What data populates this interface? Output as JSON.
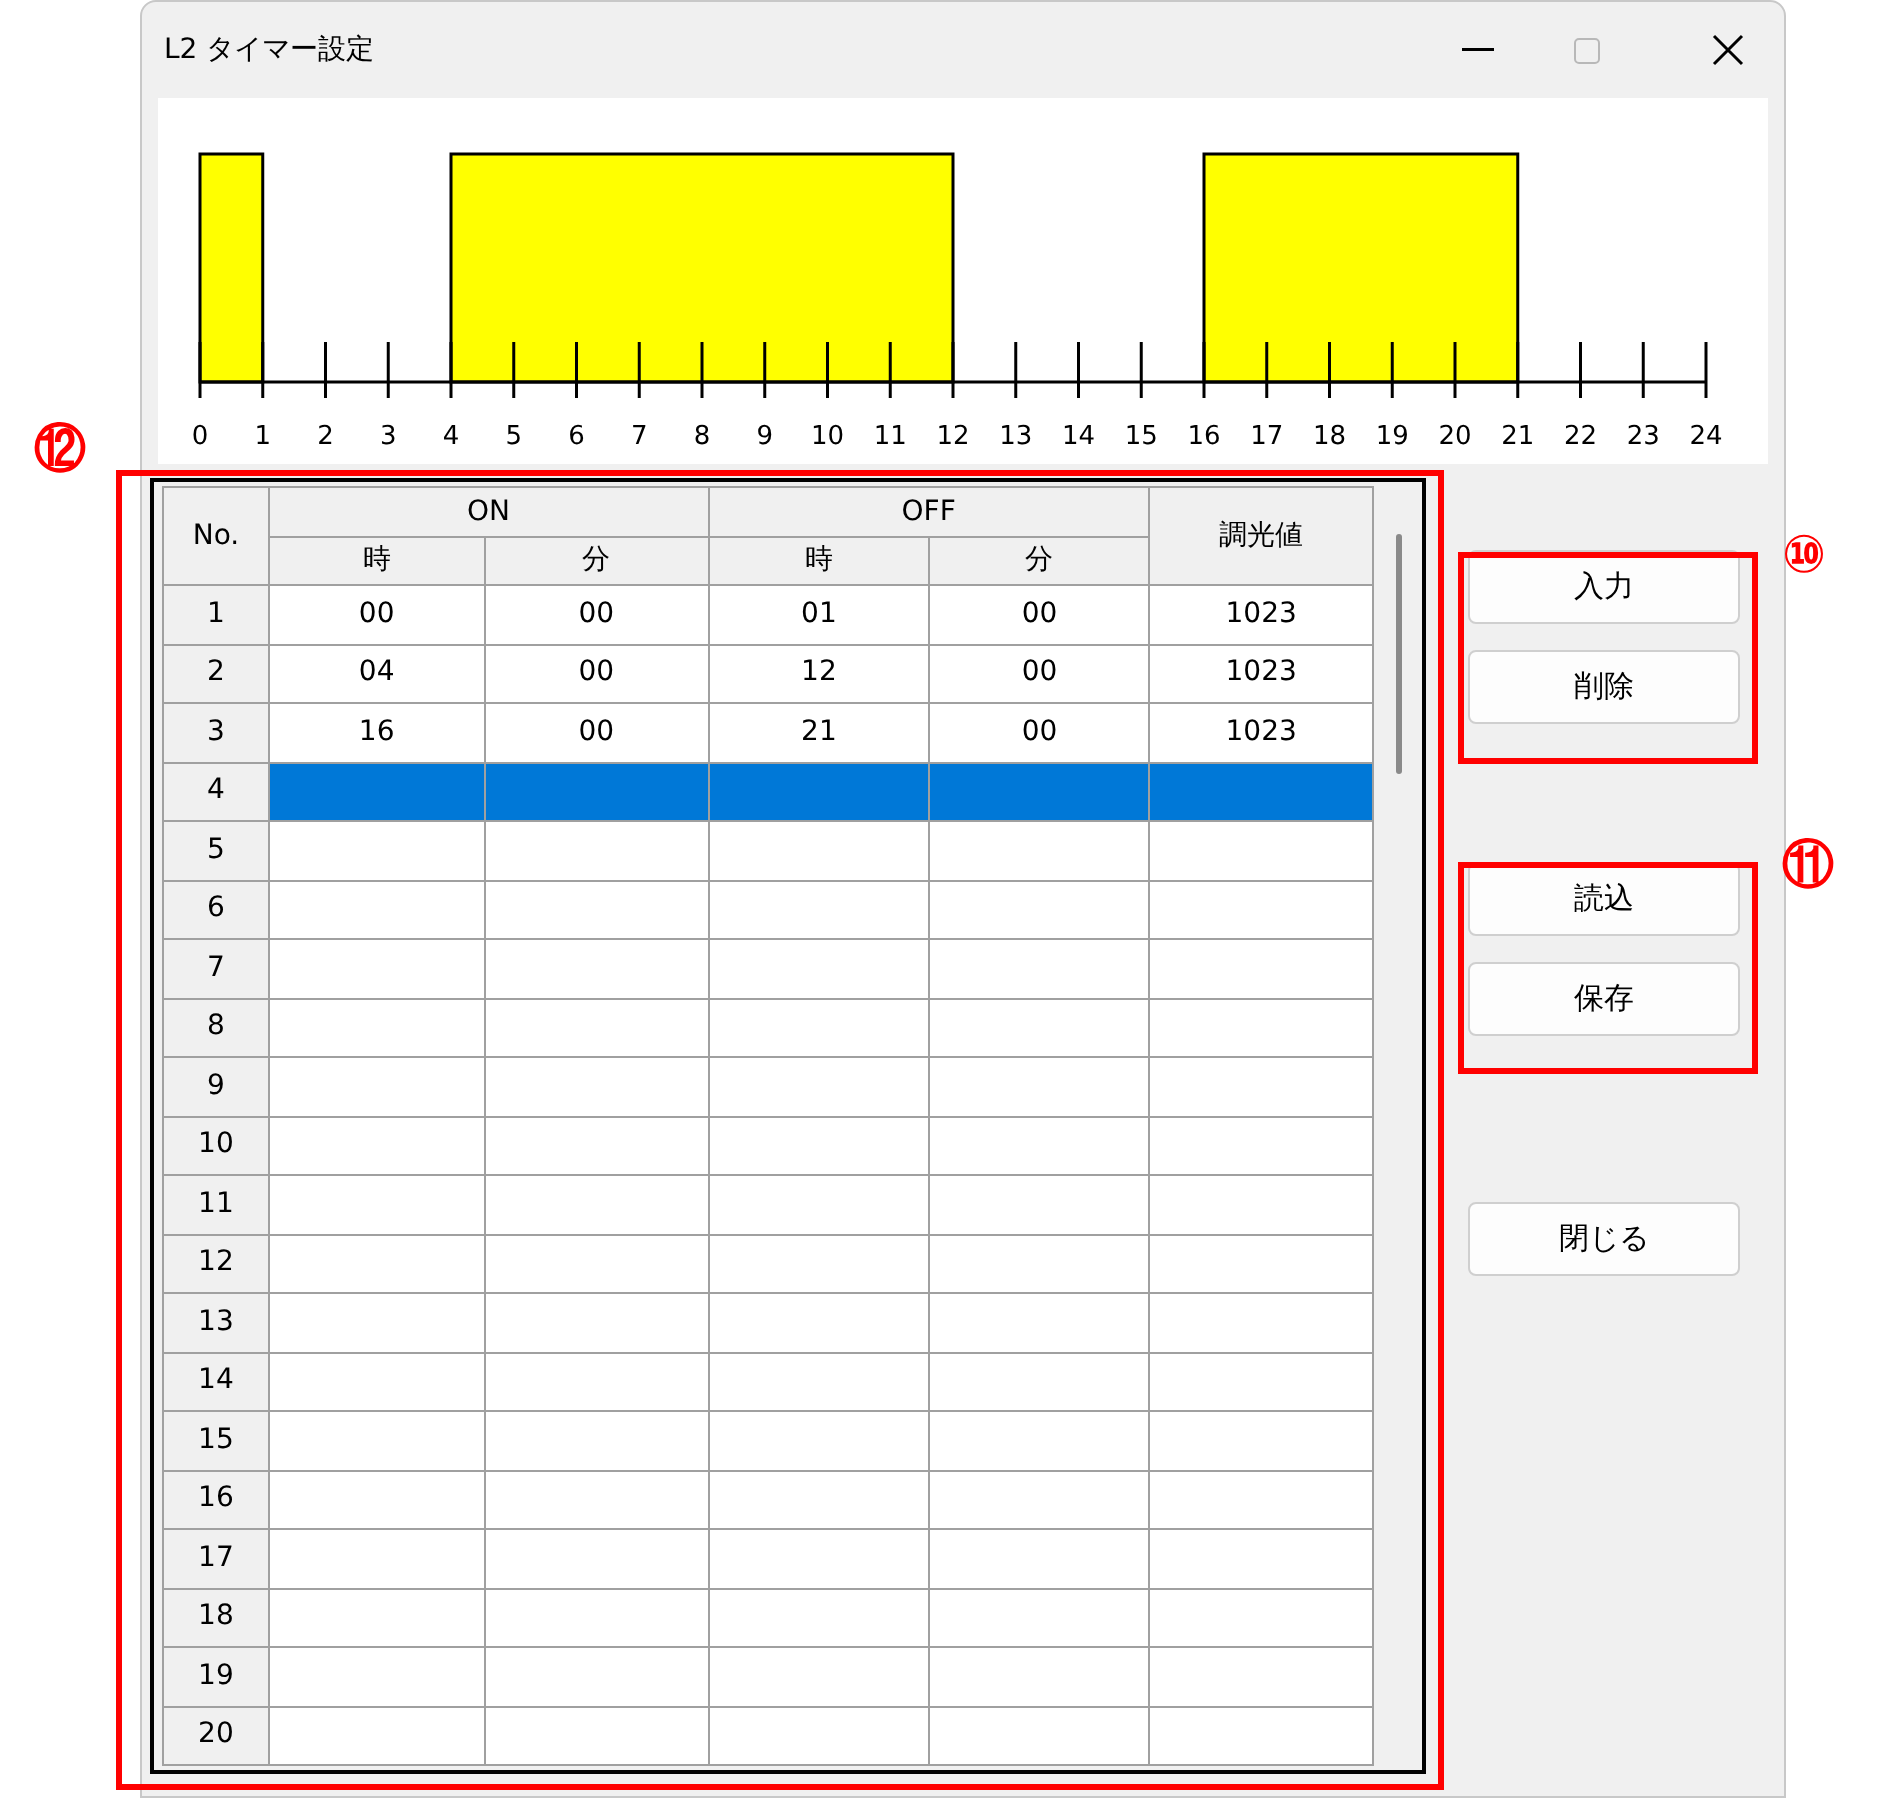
{
  "window": {
    "title": "L2 タイマー設定"
  },
  "timeline": {
    "ticks": [
      "0",
      "1",
      "2",
      "3",
      "4",
      "5",
      "6",
      "7",
      "8",
      "9",
      "10",
      "11",
      "12",
      "13",
      "14",
      "15",
      "16",
      "17",
      "18",
      "19",
      "20",
      "21",
      "22",
      "23",
      "24"
    ]
  },
  "table": {
    "annotation": "⑫",
    "headers": {
      "no": "No.",
      "on": "ON",
      "off": "OFF",
      "on_hour": "時",
      "on_min": "分",
      "off_hour": "時",
      "off_min": "分",
      "dimming": "調光値"
    },
    "rows": [
      {
        "no": "1",
        "on_hour": "00",
        "on_min": "00",
        "off_hour": "01",
        "off_min": "00",
        "dimming": "1023",
        "selected": false
      },
      {
        "no": "2",
        "on_hour": "04",
        "on_min": "00",
        "off_hour": "12",
        "off_min": "00",
        "dimming": "1023",
        "selected": false
      },
      {
        "no": "3",
        "on_hour": "16",
        "on_min": "00",
        "off_hour": "21",
        "off_min": "00",
        "dimming": "1023",
        "selected": false
      },
      {
        "no": "4",
        "selected": true
      },
      {
        "no": "5",
        "selected": false
      },
      {
        "no": "6",
        "selected": false
      },
      {
        "no": "7",
        "selected": false
      },
      {
        "no": "8",
        "selected": false
      },
      {
        "no": "9",
        "selected": false
      },
      {
        "no": "10",
        "selected": false
      },
      {
        "no": "11",
        "selected": false
      },
      {
        "no": "12",
        "selected": false
      },
      {
        "no": "13",
        "selected": false
      },
      {
        "no": "14",
        "selected": false
      },
      {
        "no": "15",
        "selected": false
      },
      {
        "no": "16",
        "selected": false
      },
      {
        "no": "17",
        "selected": false
      },
      {
        "no": "18",
        "selected": false
      },
      {
        "no": "19",
        "selected": false
      },
      {
        "no": "20",
        "selected": false
      }
    ]
  },
  "button_groups": [
    {
      "annotation": "⑩",
      "buttons": [
        "入力",
        "削除"
      ]
    },
    {
      "annotation": "⑪",
      "buttons": [
        "読込",
        "保存"
      ]
    }
  ],
  "close_button": "閉じる"
}
